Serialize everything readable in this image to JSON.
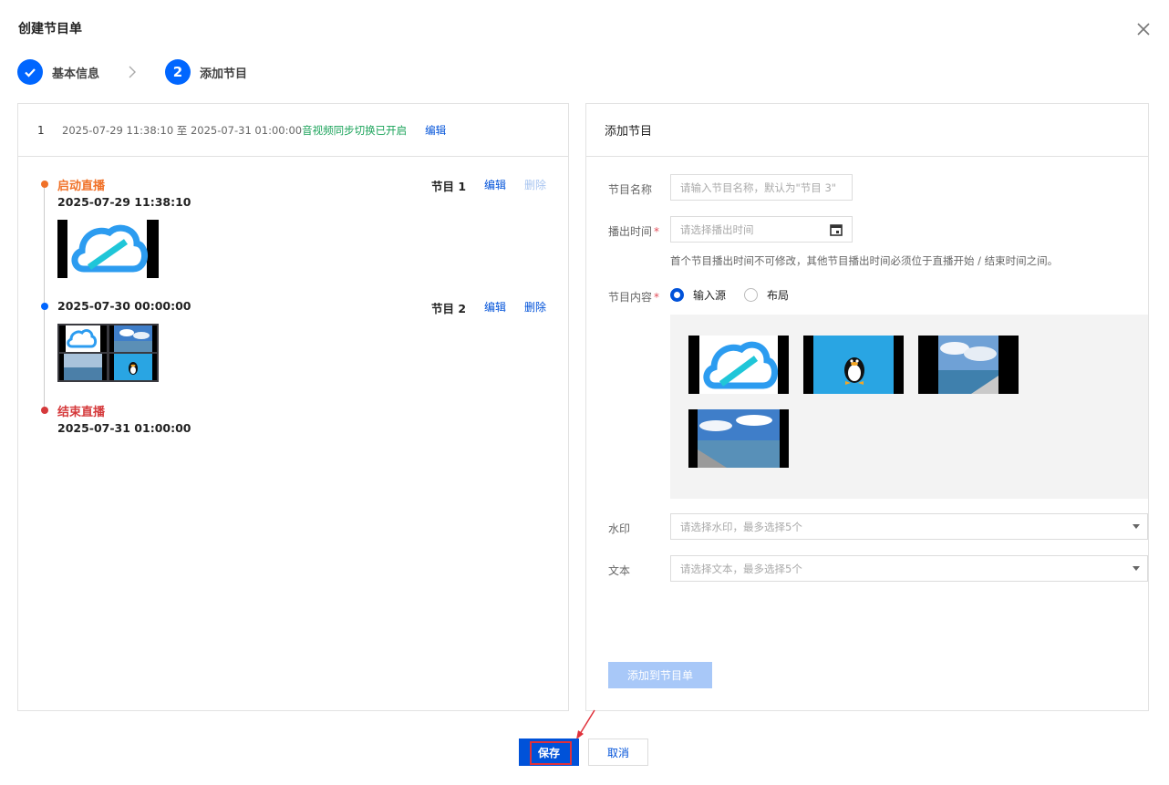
{
  "dialog": {
    "title": "创建节目单"
  },
  "steps": [
    {
      "label": "基本信息",
      "state": "done"
    },
    {
      "number": "2",
      "label": "添加节目",
      "state": "active"
    }
  ],
  "schedule": {
    "index": "1",
    "range": "2025-07-29 11:38:10 至 2025-07-31 01:00:00",
    "sync_status": "音视频同步切换已开启",
    "edit_label": "编辑"
  },
  "timeline": {
    "start": {
      "label": "启动直播",
      "time": "2025-07-29 11:38:10",
      "color": "#f07128"
    },
    "program1": {
      "label": "节目 1",
      "edit": "编辑",
      "delete": "删除"
    },
    "program2": {
      "time": "2025-07-30 00:00:00",
      "label": "节目 2",
      "edit": "编辑",
      "delete": "删除"
    },
    "end": {
      "label": "结束直播",
      "time": "2025-07-31 01:00:00",
      "color": "#d5393b"
    }
  },
  "add_program": {
    "header": "添加节目",
    "name_label": "节目名称",
    "name_placeholder": "请输入节目名称，默认为\"节目 3\"",
    "time_label": "播出时间",
    "time_placeholder": "请选择播出时间",
    "time_hint": "首个节目播出时间不可修改，其他节目播出时间必须位于直播开始 / 结束时间之间。",
    "content_label": "节目内容",
    "content_options": [
      "输入源",
      "布局"
    ],
    "content_selected": "输入源",
    "watermark_label": "水印",
    "watermark_placeholder": "请选择水印，最多选择5个",
    "text_label": "文本",
    "text_placeholder": "请选择文本，最多选择5个",
    "add_button": "添加到节目单"
  },
  "footer": {
    "save": "保存",
    "cancel": "取消"
  },
  "colors": {
    "primary": "#0052d9",
    "success": "#1ba35a",
    "danger": "#e34d59"
  }
}
